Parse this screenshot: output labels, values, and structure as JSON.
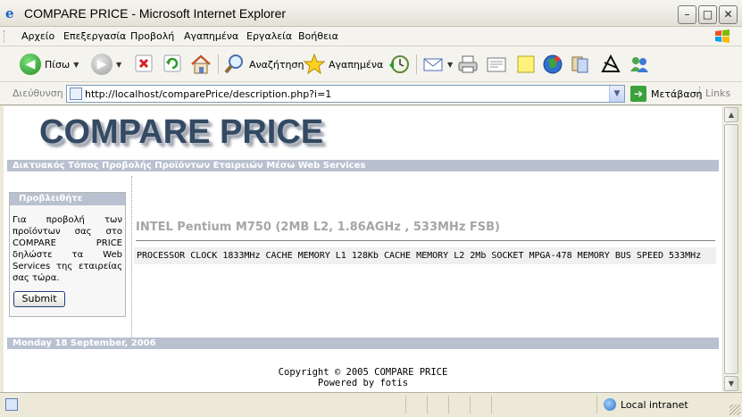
{
  "window": {
    "title": "COMPARE PRICE - Microsoft Internet Explorer",
    "minimize_glyph": "–",
    "maximize_glyph": "□",
    "close_glyph": "✕"
  },
  "menu": [
    "Αρχείο",
    "Επεξεργασία",
    "Προβολή",
    "Αγαπημένα",
    "Εργαλεία",
    "Βοήθεια"
  ],
  "toolbar": {
    "back_label": "Πίσω",
    "search_label": "Αναζήτηση",
    "favorites_label": "Αγαπημένα"
  },
  "address": {
    "label": "Διεύθυνση",
    "url": "http://localhost/comparePrice/description.php?i=1",
    "go_label": "Μετάβαση",
    "links_label": "Links"
  },
  "page": {
    "logo": "COMPARE PRICE",
    "tagline": "Δικτυακός Τόπος Προβολής Προϊόντων Εταιρειών Μέσω Web Services",
    "sidebar": {
      "heading": "Προβλειθήτε",
      "text": "Για προβολή των προϊόντων σας στο COMPARE PRICE δηλώστε τα Web Services της εταιρείας σας τώρα.",
      "submit_label": "Submit"
    },
    "product": {
      "title": "INTEL Pentium M750 (2MB L2, 1.86AGHz , 533MHz FSB)",
      "specs": "PROCESSOR CLOCK 1833MHz CACHE MEMORY L1 128Kb CACHE MEMORY L2 2Mb SOCKET MPGA-478 MEMORY BUS SPEED 533MHz"
    },
    "date": "Monday 18 September, 2006",
    "copyright": "Copyright © 2005 COMPARE PRICE",
    "powered_by": "Powered by fotis"
  },
  "status": {
    "zone": "Local intranet"
  }
}
